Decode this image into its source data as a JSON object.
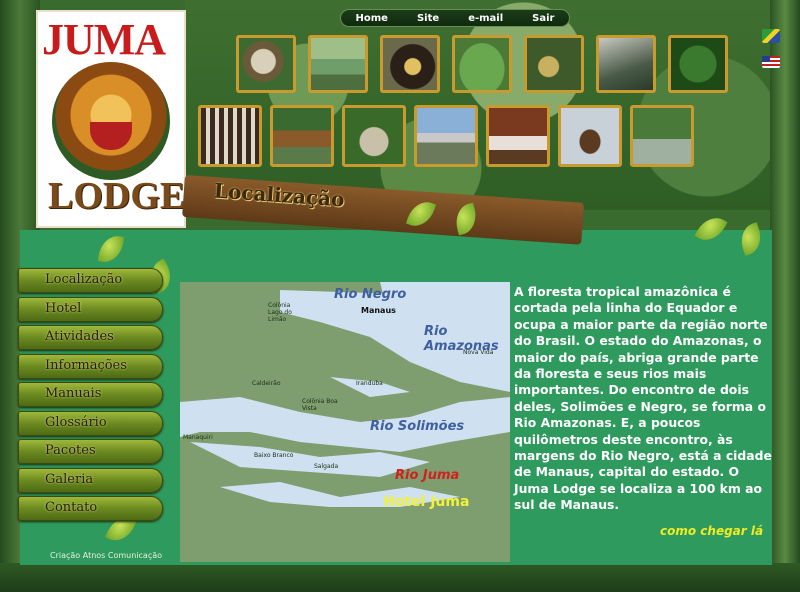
{
  "top_nav": [
    "Home",
    "Site",
    "e-mail",
    "Sair"
  ],
  "logo": {
    "word1": "JUMA",
    "word2": "LODGE"
  },
  "section_title": "Localização",
  "gallery": {
    "row1": [
      "macaco-icon",
      "canoa-icon",
      "ribeirinho-icon",
      "vitoria-regia-icon",
      "frutas-icon",
      "jacare-icon",
      "folhagem-icon"
    ],
    "row2": [
      "anta-icon",
      "cabana-icon",
      "rede-icon",
      "barco-icon",
      "quarto-icon",
      "canoe-lake-icon",
      "palafita-icon"
    ]
  },
  "flags": [
    "brazil-flag-icon",
    "usa-flag-icon"
  ],
  "menu": [
    "Localização",
    "Hotel",
    "Atividades",
    "Informações",
    "Manuais",
    "Glossário",
    "Pacotes",
    "Galeria",
    "Contato"
  ],
  "map": {
    "rivers": [
      "Rio Negro",
      "Rio Amazonas",
      "Rio Solimões"
    ],
    "manaus": "Manaus",
    "rio_juma": "Rio Juma",
    "hotel": "Hotel Juma",
    "places": [
      "Colônia Lago do Limão",
      "Nova Vida",
      "Caldeirão",
      "Iranduba",
      "Colônia Boa Vista",
      "Manaquiri",
      "Baixo Branco",
      "Salgada"
    ]
  },
  "description": "A floresta tropical amazônica é cortada pela linha do Equador e ocupa a maior parte da região norte do Brasil. O estado do Amazonas, o maior do país, abriga grande parte da floresta e seus rios mais importantes. Do encontro de dois deles, Solimões e Negro, se forma o Rio Amazonas. E, a poucos quilômetros deste encontro, às margens do Rio Negro, está a cidade de Manaus, capital do estado. O Juma Lodge se localiza a 100 km ao sul de Manaus.",
  "como_chegar": "como chegar lá",
  "credit": "Criação Atnos Comunicação"
}
